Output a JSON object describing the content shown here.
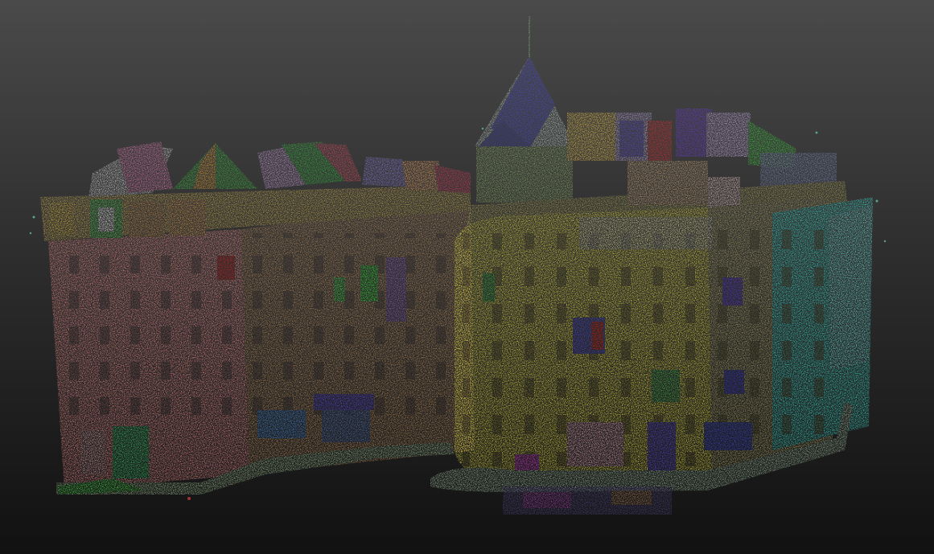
{
  "viewer": {
    "background_top": "#4a4a4a",
    "background_bottom": "#111111"
  },
  "point_cloud": {
    "segment_palette": [
      "#f28a8a",
      "#e8e23a",
      "#3ecf3e",
      "#3a3ad8",
      "#a04ad8",
      "#2ed8d0",
      "#e03030",
      "#ff9a3a",
      "#d8d8d8",
      "#6a6ad8"
    ]
  }
}
